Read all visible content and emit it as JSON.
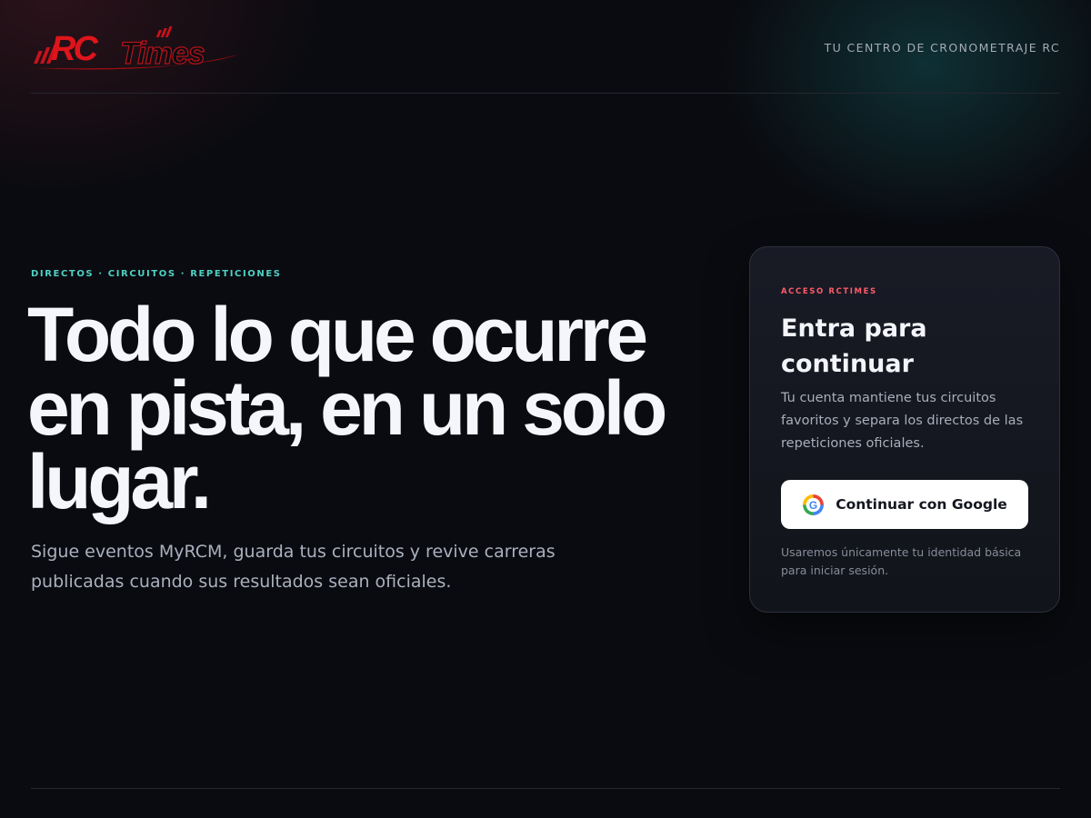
{
  "header": {
    "logo_text": "RCTimes",
    "tagline": "TU CENTRO DE CRONOMETRAJE RC"
  },
  "hero": {
    "eyebrow": "DIRECTOS · CIRCUITOS · REPETICIONES",
    "headline": "Todo lo que ocurre en pista, en un solo lugar.",
    "subhead": "Sigue eventos MyRCM, guarda tus circuitos y revive carreras publicadas cuando sus resultados sean oficiales."
  },
  "login_card": {
    "eyebrow": "ACCESO RCTIMES",
    "title": "Entra para continuar",
    "description": "Tu cuenta mantiene tus circuitos favoritos y separa los directos de las repeticiones oficiales.",
    "google_button_label": "Continuar con Google",
    "google_icon": "google-g-icon",
    "note": "Usaremos únicamente tu identidad básica para iniciar sesión."
  },
  "colors": {
    "background": "#0a0b10",
    "accent_teal": "#4fd1c5",
    "accent_red": "#ff5a6a",
    "logo_red": "#e0141b",
    "button_bg": "#ffffff"
  }
}
